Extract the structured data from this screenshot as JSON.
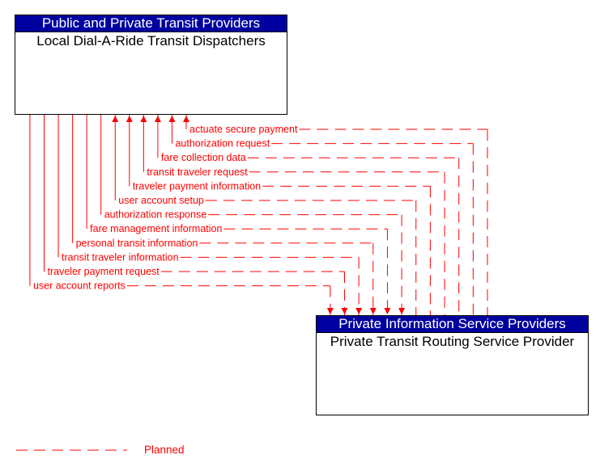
{
  "diagram": {
    "top_entity": {
      "group": "Public and Private Transit Providers",
      "name": "Local Dial-A-Ride Transit Dispatchers"
    },
    "bottom_entity": {
      "group": "Private Information Service Providers",
      "name": "Private Transit Routing Service Provider"
    },
    "flows": [
      {
        "label": "actuate secure payment",
        "direction": "to-top",
        "status": "Planned"
      },
      {
        "label": "authorization request",
        "direction": "to-top",
        "status": "Planned"
      },
      {
        "label": "fare collection data",
        "direction": "to-top",
        "status": "Planned"
      },
      {
        "label": "transit traveler request",
        "direction": "to-top",
        "status": "Planned"
      },
      {
        "label": "traveler payment information",
        "direction": "to-top",
        "status": "Planned"
      },
      {
        "label": "user account setup",
        "direction": "to-top",
        "status": "Planned"
      },
      {
        "label": "authorization response",
        "direction": "to-bottom",
        "status": "Planned"
      },
      {
        "label": "fare management information",
        "direction": "to-bottom",
        "status": "Planned"
      },
      {
        "label": "personal transit information",
        "direction": "to-bottom",
        "status": "Planned"
      },
      {
        "label": "transit traveler information",
        "direction": "to-bottom",
        "status": "Planned"
      },
      {
        "label": "traveler payment request",
        "direction": "to-bottom",
        "status": "Planned"
      },
      {
        "label": "user account reports",
        "direction": "to-bottom",
        "status": "Planned"
      }
    ],
    "colors": {
      "flow": "#ff0000",
      "header_bg": "#0000a0",
      "header_text": "#ffffff"
    },
    "legend": {
      "label": "Planned",
      "line_style": "dashed"
    }
  }
}
